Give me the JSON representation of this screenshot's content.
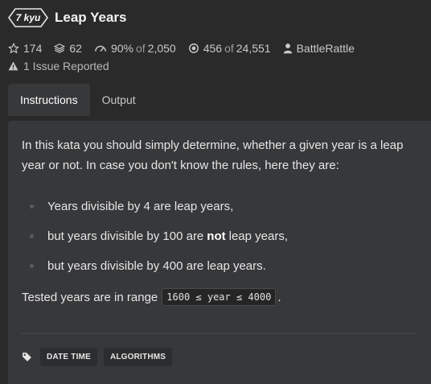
{
  "kata": {
    "rank": "7 kyu",
    "title": "Leap Years"
  },
  "stats": {
    "stars": "174",
    "collections": "62",
    "satisfaction_pct": "90%",
    "satisfaction_of": "of",
    "satisfaction_votes": "2,050",
    "completed": "456",
    "completed_of": "of",
    "attempts": "24,551",
    "author": "BattleRattle",
    "issues": "1 Issue Reported"
  },
  "tabs": [
    {
      "label": "Instructions",
      "active": true
    },
    {
      "label": "Output",
      "active": false
    }
  ],
  "instructions": {
    "intro": "In this kata you should simply determine, whether a given year is a leap year or not. In case you don't know the rules, here they are:",
    "rules": [
      {
        "before": "Years divisible by 4 are leap years,",
        "bold": "",
        "after": ""
      },
      {
        "before": "but years divisible by 100 are",
        "bold": "not",
        "after": "leap years,"
      },
      {
        "before": "but years divisible by 400 are leap years.",
        "bold": "",
        "after": ""
      }
    ],
    "range_prefix": "Tested years are in range",
    "range_code": "1600 ≤ year ≤ 4000",
    "range_suffix": "."
  },
  "tags": [
    "DATE TIME",
    "ALGORITHMS"
  ],
  "icons": {
    "rank_badge": "hexagon-badge",
    "stars": "star-icon",
    "collections": "layers-icon",
    "satisfaction": "gauge-icon",
    "completed": "target-icon",
    "author": "user-icon",
    "issues": "warning-icon",
    "tags": "tag-icon"
  },
  "colors": {
    "background": "#2a2a2b",
    "panel": "#37383a",
    "text": "#e6e6e6",
    "muted": "#9a9a9a"
  }
}
